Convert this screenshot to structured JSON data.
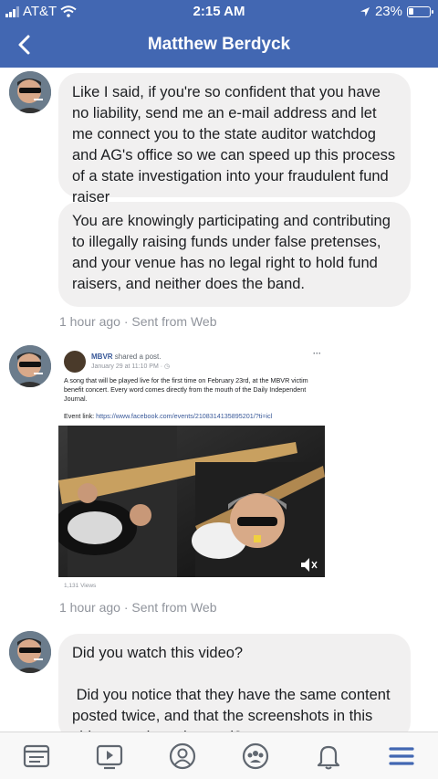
{
  "status_bar": {
    "carrier": "AT&T",
    "time": "2:15 AM",
    "battery_percent": "23%",
    "battery_level": 0.23
  },
  "header": {
    "title": "Matthew Berdyck",
    "back_icon": "chevron-left-icon"
  },
  "messages": [
    {
      "text": "Like I said, if you're so confident that you have no liability, send me an e-mail address and let me connect you to the state auditor watchdog and AG's office so we can speed up this process of a state investigation into your fraudulent fund raiser"
    },
    {
      "text": "You are knowingly participating and contributing to illegally raising funds under false pretenses, and your venue has no legal right to hold fund raisers, and neither does the band."
    },
    {
      "text": "Did you watch this video?\n\n Did you notice that they have the same content posted twice, and that the screenshots in this video are photoshopped?"
    }
  ],
  "meta": {
    "first": "1 hour ago · Sent from Web",
    "second": "1 hour ago · Sent from Web"
  },
  "shared_post": {
    "author": "MBVR",
    "action": " shared a post.",
    "date": "January 29 at 11:10 PM · ",
    "more": "···",
    "text": "A song that will be played live for the first time on February 23rd, at the MBVR victim benefit concert. Every word comes directly from the mouth of the Daily Independent Journal.",
    "link_label": "Event link: ",
    "link_url": "https://www.facebook.com/events/2108314135895201/?ti=icl",
    "views": "1,131 Views"
  },
  "tabbar": {
    "items": [
      "news-feed-icon",
      "watch-icon",
      "profile-icon",
      "groups-icon",
      "notifications-icon",
      "menu-icon"
    ],
    "active_color": "#4267b2"
  },
  "colors": {
    "brand": "#4267b2",
    "bubble": "#f1f0f0",
    "meta_text": "#90949c"
  }
}
